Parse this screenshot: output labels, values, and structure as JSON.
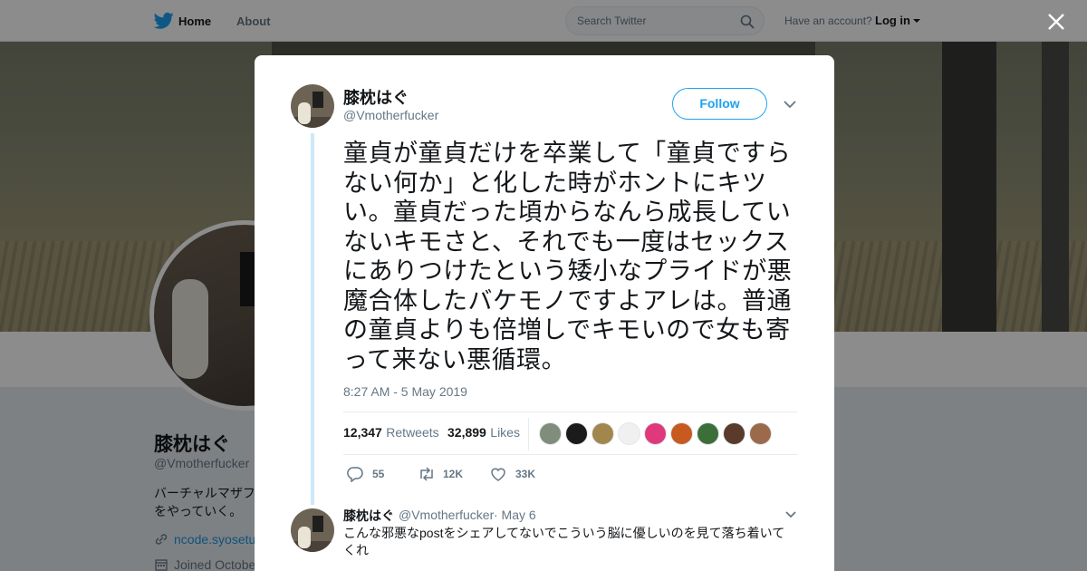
{
  "nav": {
    "home_label": "Home",
    "about_label": "About",
    "search_placeholder": "Search Twitter",
    "have_account": "Have an account?",
    "login_label": "Log in"
  },
  "profile": {
    "name": "膝枕はぐ",
    "handle": "@Vmotherfucker",
    "bio": "バーチャルマザファ\nをやっていく。",
    "link": "ncode.syosetu",
    "joined": "Joined October"
  },
  "tweet": {
    "author_name": "膝枕はぐ",
    "author_handle": "@Vmotherfucker",
    "follow_label": "Follow",
    "text": "童貞が童貞だけを卒業して「童貞ですらない何か」と化した時がホントにキツい。童貞だった頃からなんら成長していないキモさと、それでも一度はセックスにありつけたという矮小なプライドが悪魔合体したバケモノですよアレは。普通の童貞よりも倍増しでキモいので女も寄って来ない悪循環。",
    "timestamp": "8:27 AM - 5 May 2019",
    "retweets_count": "12,347",
    "retweets_label": "Retweets",
    "likes_count": "32,899",
    "likes_label": "Likes",
    "liker_colors": [
      "#7f8d7a",
      "#1b1b1b",
      "#a2874c",
      "#f0f0f0",
      "#e0397b",
      "#c75a1f",
      "#3c6e3a",
      "#5a3a2a",
      "#9b6a4a"
    ],
    "reply_count": "55",
    "retweet_action_count": "12K",
    "like_action_count": "33K"
  },
  "reply": {
    "name": "膝枕はぐ",
    "handle": "@Vmotherfucker",
    "date": "· May 6",
    "text": "こんな邪悪なpostをシェアしてないでこういう脳に優しいのを見て落ち着いてくれ"
  },
  "colors": {
    "accent": "#1da1f2",
    "thread_line": "#cde8fb",
    "secondary_text": "#657786"
  }
}
